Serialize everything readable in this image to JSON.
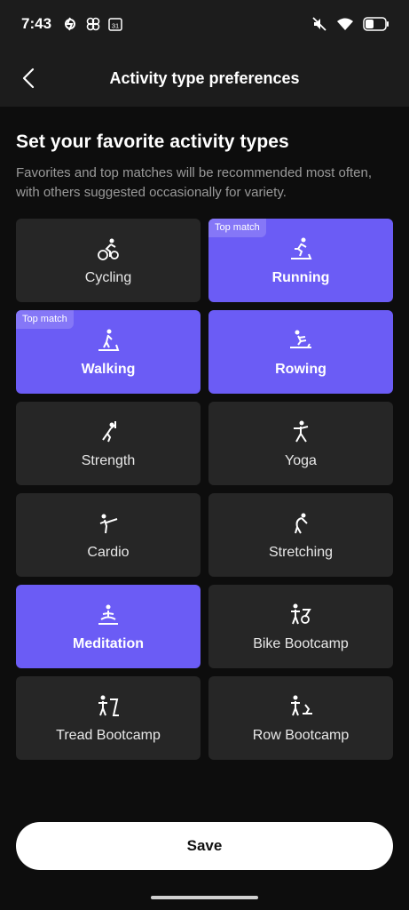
{
  "status_bar": {
    "time": "7:43",
    "calendar_day": "31",
    "left_icons": [
      "peloton-icon",
      "pinwheel-icon",
      "calendar-icon"
    ],
    "right_icons": [
      "mute-icon",
      "wifi-icon",
      "battery-icon"
    ]
  },
  "header": {
    "title": "Activity type preferences",
    "back_icon": "chevron-left-icon"
  },
  "section": {
    "title": "Set your favorite activity types",
    "description": "Favorites and top matches will be recommended most often, with others suggested occasionally for variety."
  },
  "colors": {
    "selected": "#6b5cf5",
    "unselected": "#262626",
    "badge": "#8577f7"
  },
  "activities": [
    {
      "label": "Cycling",
      "icon": "cycling-icon",
      "selected": false,
      "badge": ""
    },
    {
      "label": "Running",
      "icon": "running-icon",
      "selected": true,
      "badge": "Top match"
    },
    {
      "label": "Walking",
      "icon": "walking-icon",
      "selected": true,
      "badge": "Top match"
    },
    {
      "label": "Rowing",
      "icon": "rowing-icon",
      "selected": true,
      "badge": ""
    },
    {
      "label": "Strength",
      "icon": "strength-icon",
      "selected": false,
      "badge": ""
    },
    {
      "label": "Yoga",
      "icon": "yoga-icon",
      "selected": false,
      "badge": ""
    },
    {
      "label": "Cardio",
      "icon": "cardio-icon",
      "selected": false,
      "badge": ""
    },
    {
      "label": "Stretching",
      "icon": "stretching-icon",
      "selected": false,
      "badge": ""
    },
    {
      "label": "Meditation",
      "icon": "meditation-icon",
      "selected": true,
      "badge": ""
    },
    {
      "label": "Bike Bootcamp",
      "icon": "bike-bootcamp-icon",
      "selected": false,
      "badge": ""
    },
    {
      "label": "Tread Bootcamp",
      "icon": "tread-bootcamp-icon",
      "selected": false,
      "badge": ""
    },
    {
      "label": "Row Bootcamp",
      "icon": "row-bootcamp-icon",
      "selected": false,
      "badge": ""
    }
  ],
  "save_label": "Save"
}
